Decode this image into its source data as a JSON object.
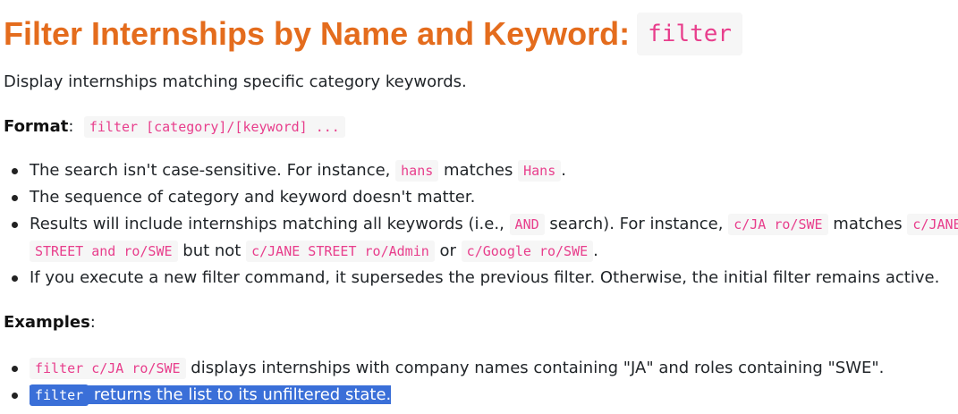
{
  "heading": {
    "text": "Filter Internships by Name and Keyword:",
    "command": "filter"
  },
  "description": "Display internships matching specific category keywords.",
  "format": {
    "label": "Format",
    "colon": ":",
    "code": "filter [category]/[keyword] ..."
  },
  "notes": {
    "n1": {
      "a": "The search isn't case-sensitive. For instance,",
      "code1": "hans",
      "b": "matches",
      "code2": "Hans",
      "c": "."
    },
    "n2": {
      "a": "The sequence of category and keyword doesn't matter."
    },
    "n3": {
      "a": "Results will include internships matching all keywords (i.e.,",
      "code1": "AND",
      "b": "search). For instance,",
      "code2": "c/JA ro/SWE",
      "c": "matches",
      "code3a": "c/JANE",
      "code3b": "STREET and ro/SWE",
      "d": "but not",
      "code4": "c/JANE STREET ro/Admin",
      "e": "or",
      "code5": "c/Google ro/SWE",
      "f": "."
    },
    "n4": {
      "a": "If you execute a new filter command, it supersedes the previous filter. Otherwise, the initial filter remains active."
    }
  },
  "examples": {
    "label": "Examples",
    "colon": ":",
    "e1": {
      "code": "filter c/JA ro/SWE",
      "text": "displays internships with company names containing \"JA\" and roles containing \"SWE\"."
    },
    "e2": {
      "code": "filter",
      "text": "returns the list to its unfiltered state."
    }
  }
}
